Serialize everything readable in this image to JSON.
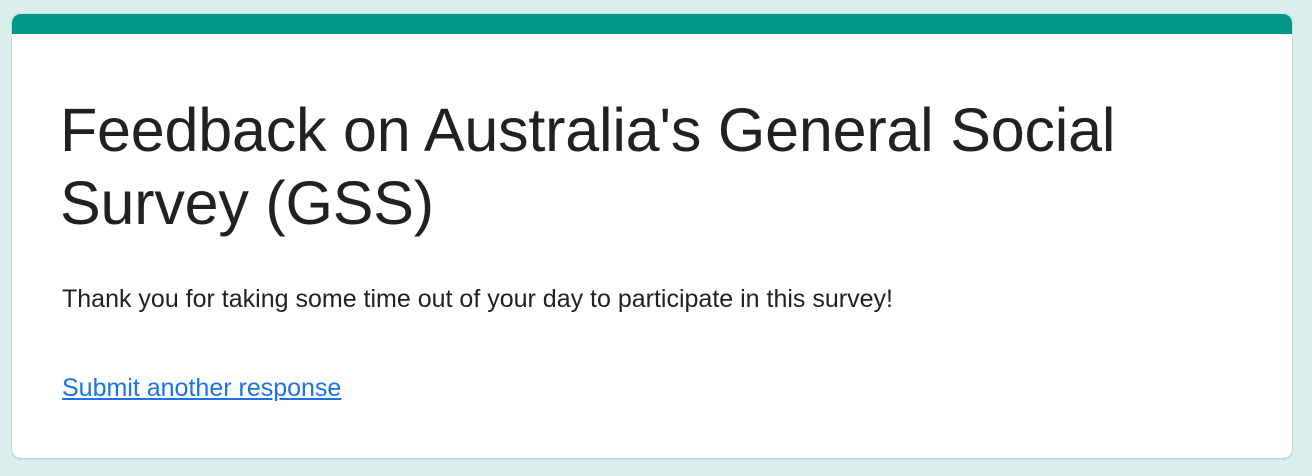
{
  "colors": {
    "accent": "#009688",
    "link": "#1a73e8",
    "background": "#d9efec"
  },
  "form": {
    "title": "Feedback on Australia's General Social Survey (GSS)",
    "confirmation_message": "Thank you for taking some time out of your day to participate in this survey!",
    "submit_another_label": "Submit another response"
  }
}
